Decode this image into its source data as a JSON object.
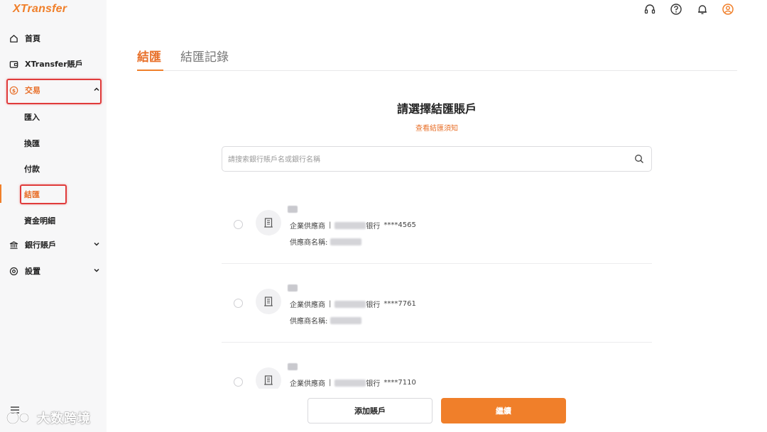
{
  "app": {
    "logo": "XTransfer"
  },
  "sidebar": {
    "items": [
      {
        "label": "首頁",
        "icon": "home-icon"
      },
      {
        "label": "XTransfer賬戶",
        "icon": "wallet-icon"
      },
      {
        "label": "交易",
        "icon": "dollar-circle-icon",
        "expanded": true,
        "children": [
          "匯入",
          "換匯",
          "付款",
          "結匯",
          "資金明細"
        ]
      },
      {
        "label": "銀行賬戶",
        "icon": "bank-icon"
      },
      {
        "label": "設置",
        "icon": "settings-icon"
      }
    ],
    "active_child": "結匯"
  },
  "topbar": {
    "icons": [
      "headset-icon",
      "help-icon",
      "bell-icon",
      "user-icon"
    ]
  },
  "tabs": [
    {
      "label": "結匯",
      "active": true
    },
    {
      "label": "結匯記錄",
      "active": false
    }
  ],
  "main": {
    "title": "請選擇結匯賬戶",
    "notice_link": "查看結匯須知",
    "search_placeholder": "請搜索銀行賬戶名或銀行名稱"
  },
  "accounts": [
    {
      "type": "企業供應商",
      "bank_suffix": "银行",
      "account_masked": "****4565",
      "supplier_label": "供應商名稱:"
    },
    {
      "type": "企業供應商",
      "bank_suffix": "银行",
      "account_masked": "****7761",
      "supplier_label": "供應商名稱:"
    },
    {
      "type": "企業供應商",
      "bank_suffix": "银行",
      "account_masked": "****7110"
    }
  ],
  "buttons": {
    "add": "添加賬戶",
    "continue": "繼續"
  },
  "watermark": "大数跨境",
  "colors": {
    "accent": "#f07f2a",
    "highlight_box": "#e03b3b"
  }
}
